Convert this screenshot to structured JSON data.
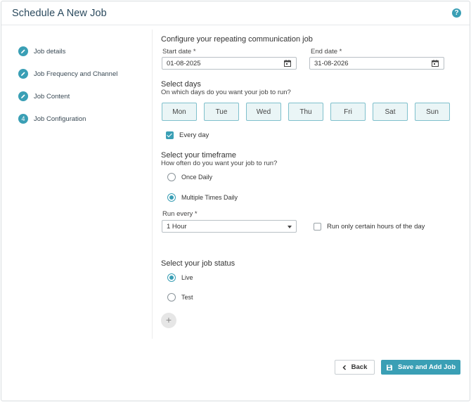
{
  "header": {
    "title": "Schedule A New Job",
    "help_icon": "help-circle-icon",
    "help_glyph": "?"
  },
  "steps": [
    {
      "label": "Job details",
      "marker": "pencil"
    },
    {
      "label": "Job Frequency and Channel",
      "marker": "pencil"
    },
    {
      "label": "Job Content",
      "marker": "pencil"
    },
    {
      "label": "Job Configuration",
      "marker": "4"
    }
  ],
  "configure": {
    "title": "Configure your repeating communication job",
    "start_label": "Start date *",
    "start_value": "01-08-2025",
    "end_label": "End date *",
    "end_value": "31-08-2026"
  },
  "days": {
    "title": "Select days",
    "subtitle": "On which days do you want your job to run?",
    "items": [
      "Mon",
      "Tue",
      "Wed",
      "Thu",
      "Fri",
      "Sat",
      "Sun"
    ],
    "every_day_label": "Every day",
    "every_day_checked": true
  },
  "timeframe": {
    "title": "Select your timeframe",
    "subtitle": "How often do you want your job to run?",
    "options": [
      "Once Daily",
      "Multiple Times Daily"
    ],
    "selected": "Multiple Times Daily",
    "run_every_label": "Run every *",
    "run_every_value": "1 Hour",
    "certain_hours_label": "Run only certain hours of the day",
    "certain_hours_checked": false
  },
  "status": {
    "title": "Select your job status",
    "options": [
      "Live",
      "Test"
    ],
    "selected": "Live"
  },
  "add_glyph": "+",
  "footer": {
    "back_label": "Back",
    "save_label": "Save and Add Job"
  },
  "colors": {
    "accent": "#3a9fb5",
    "title_text": "#2b4a5e"
  }
}
